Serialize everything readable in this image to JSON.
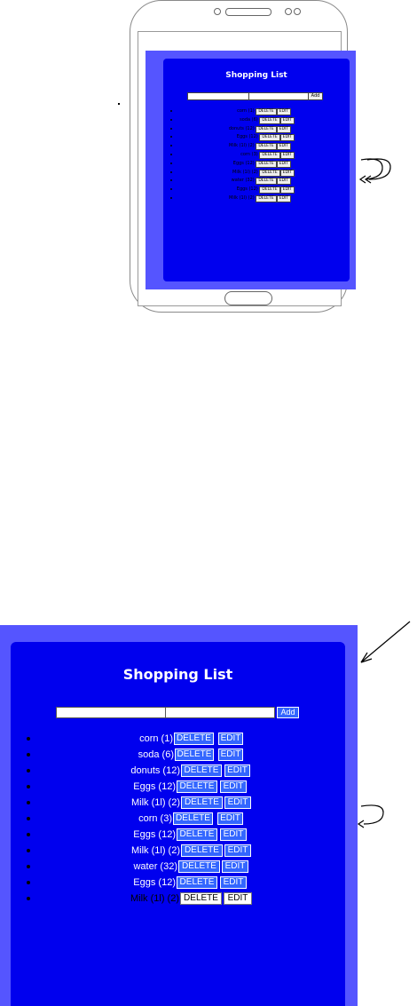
{
  "mockup": {
    "title": "Shopping List",
    "add_label": "Add",
    "delete_label": "DELETE",
    "edit_label": "EDIT"
  },
  "app": {
    "title": "Shopping List",
    "input_item": {
      "value": "",
      "placeholder": ""
    },
    "input_qty": {
      "value": "",
      "placeholder": ""
    },
    "add_label": "Add",
    "delete_label": "DELETE",
    "edit_label": "EDIT",
    "items": [
      {
        "text": "corn (1)"
      },
      {
        "text": "soda (6)"
      },
      {
        "text": "donuts (12)"
      },
      {
        "text": "Eggs (12)"
      },
      {
        "text": "Milk (1l) (2)"
      },
      {
        "text": "corn (3)"
      },
      {
        "text": "Eggs (12)"
      },
      {
        "text": "Milk (1l) (2)"
      },
      {
        "text": "water (32)"
      },
      {
        "text": "Eggs (12)"
      },
      {
        "text": "Milk (1l) (2)"
      }
    ]
  },
  "colors": {
    "outer": "#5555ff",
    "panel": "#0000ee",
    "button": "#3366ff"
  }
}
